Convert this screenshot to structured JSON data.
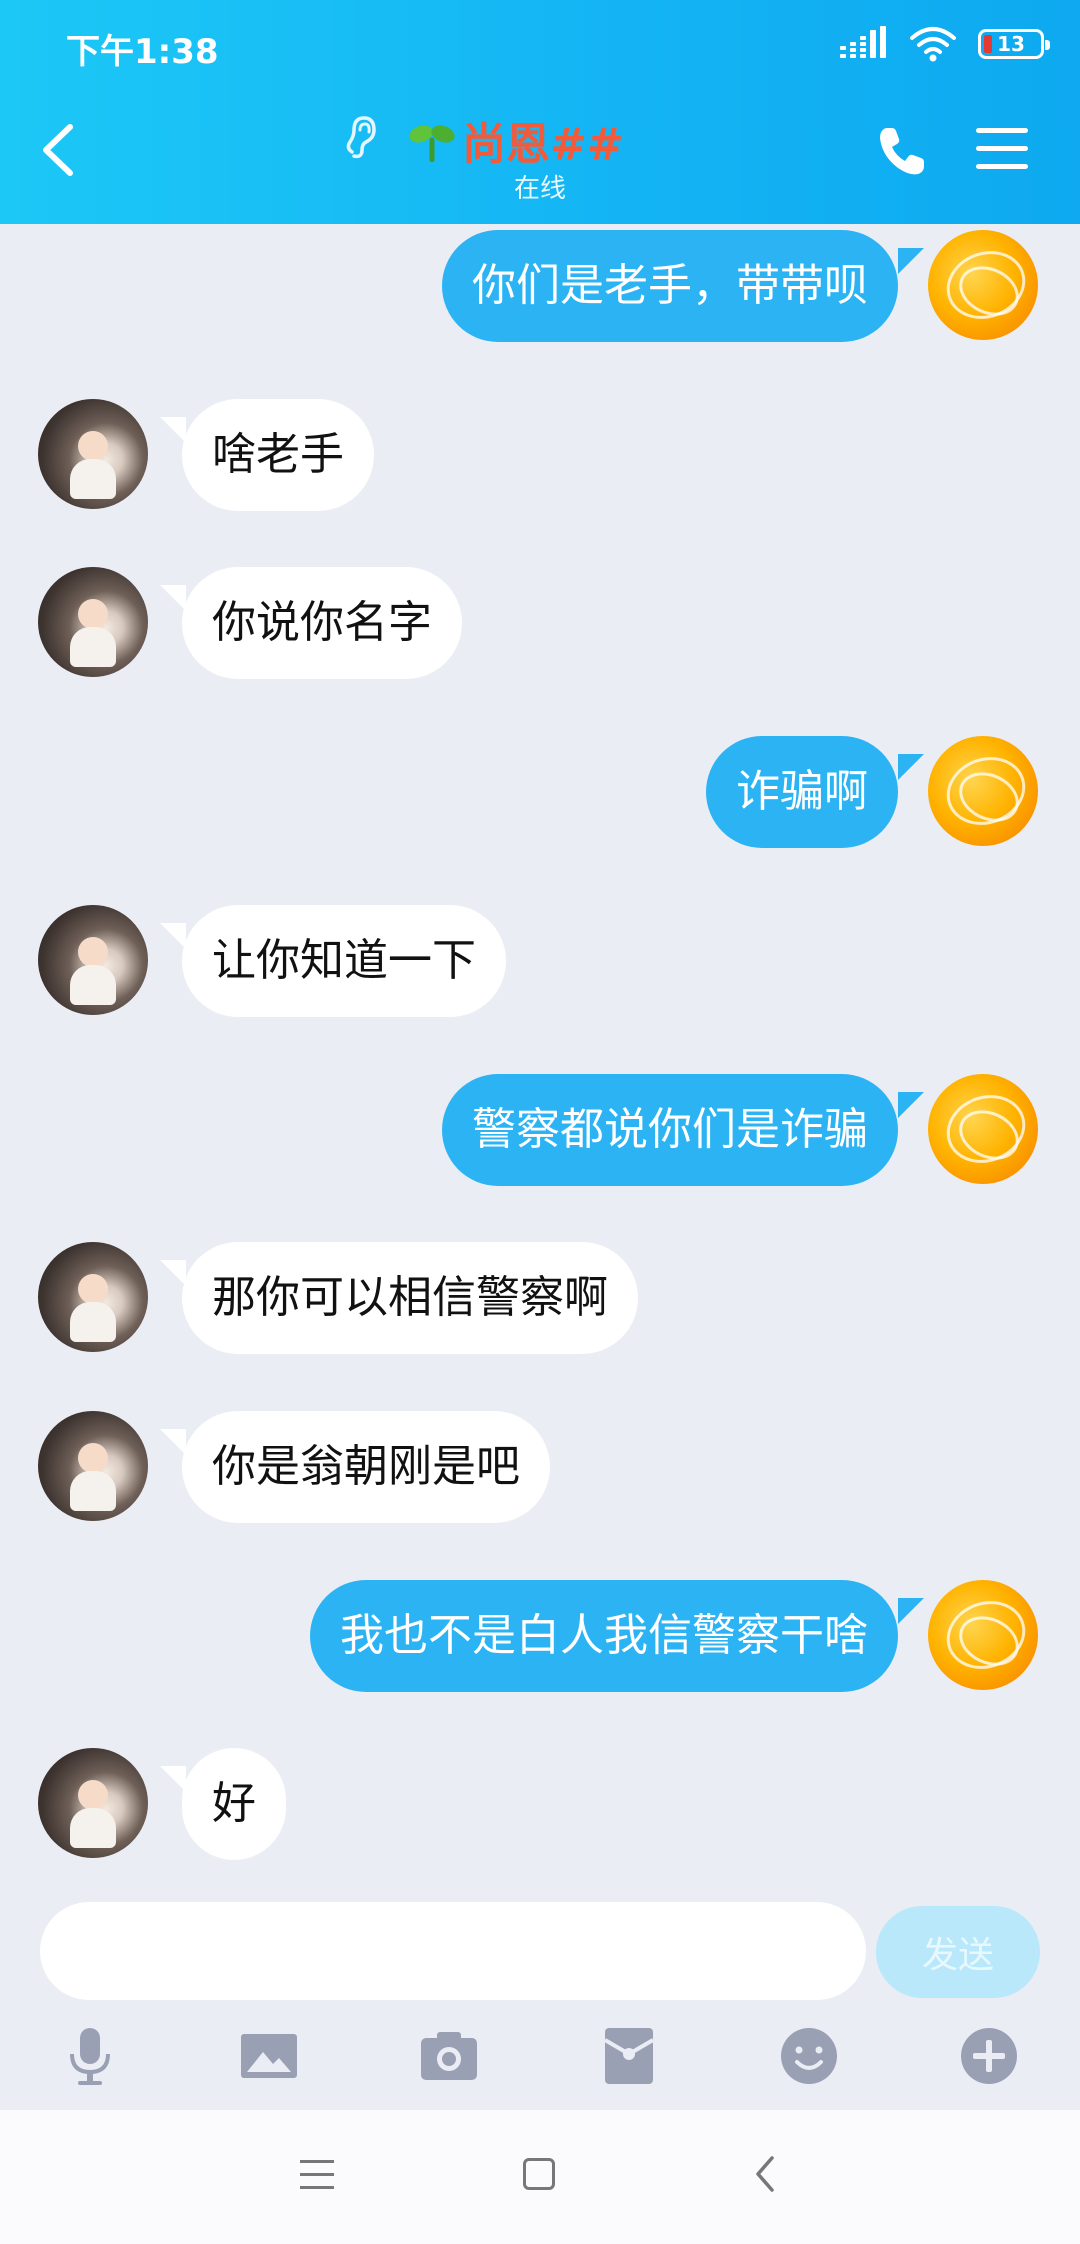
{
  "status_bar": {
    "time": "下午1:38",
    "battery": "13"
  },
  "header": {
    "contact_name": "尚恩##",
    "status": "在线"
  },
  "colors": {
    "header": "#14b5f4",
    "bubble_me": "#2bb3f4",
    "bubble_other": "#ffffff",
    "name": "#f25a39",
    "background": "#ebedf5"
  },
  "messages": [
    {
      "sender": "me",
      "text": "你们是老手，带带呗"
    },
    {
      "sender": "other",
      "text": "啥老手"
    },
    {
      "sender": "other",
      "text": "你说你名字"
    },
    {
      "sender": "me",
      "text": "诈骗啊"
    },
    {
      "sender": "other",
      "text": "让你知道一下"
    },
    {
      "sender": "me",
      "text": "警察都说你们是诈骗"
    },
    {
      "sender": "other",
      "text": "那你可以相信警察啊"
    },
    {
      "sender": "other",
      "text": "你是翁朝刚是吧"
    },
    {
      "sender": "me",
      "text": "我也不是白人我信警察干啥"
    },
    {
      "sender": "other",
      "text": "好"
    }
  ],
  "input": {
    "placeholder": "",
    "value": "",
    "send_label": "发送"
  },
  "toolbar": [
    "mic-icon",
    "image-icon",
    "camera-icon",
    "red-packet-icon",
    "emoji-icon",
    "plus-icon"
  ]
}
